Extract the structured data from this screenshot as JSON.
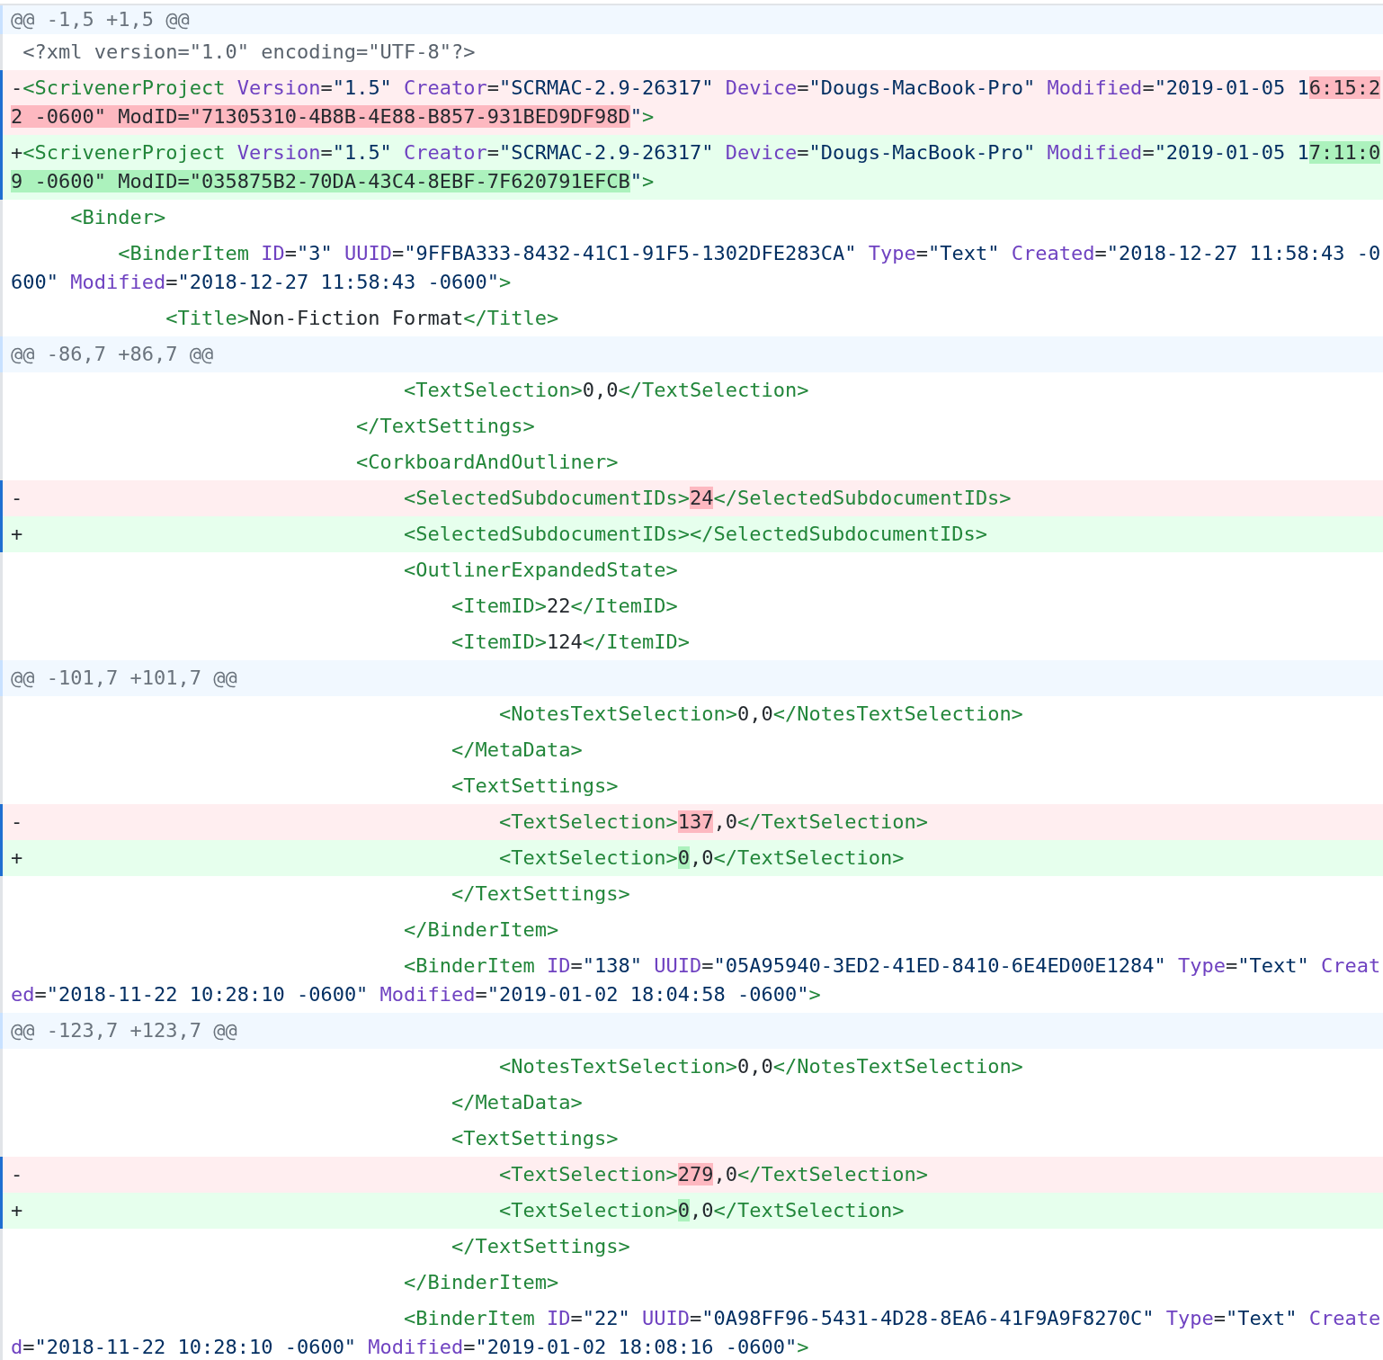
{
  "lines": [
    {
      "kind": "hunk",
      "text": "@@ -1,5 +1,5 @@"
    },
    {
      "kind": "context",
      "segments": [
        {
          "kind": "decl",
          "text": " <?xml version=\"1.0\" encoding=\"UTF-8\"?>",
          "highlighted": false
        }
      ]
    },
    {
      "kind": "del",
      "segments": [
        {
          "kind": "plain",
          "text": "-",
          "highlighted": false
        },
        {
          "kind": "tag",
          "text": "<ScrivenerProject",
          "highlighted": false
        },
        {
          "kind": "attr",
          "text": " Version",
          "highlighted": false
        },
        {
          "kind": "plain",
          "text": "=",
          "highlighted": false
        },
        {
          "kind": "str",
          "text": "\"1.5\"",
          "highlighted": false
        },
        {
          "kind": "attr",
          "text": " Creator",
          "highlighted": false
        },
        {
          "kind": "plain",
          "text": "=",
          "highlighted": false
        },
        {
          "kind": "str",
          "text": "\"SCRMAC-2.9-26317\"",
          "highlighted": false
        },
        {
          "kind": "attr",
          "text": " Device",
          "highlighted": false
        },
        {
          "kind": "plain",
          "text": "=",
          "highlighted": false
        },
        {
          "kind": "str",
          "text": "\"Dougs-MacBook-Pro\"",
          "highlighted": false
        },
        {
          "kind": "attr",
          "text": " Modified",
          "highlighted": false
        },
        {
          "kind": "plain",
          "text": "=",
          "highlighted": false
        },
        {
          "kind": "str",
          "text": "\"2019-01-05 1",
          "highlighted": false
        },
        {
          "kind": "plain",
          "text": "6:15:22 -0600\" ModID=\"71305310-4B8B-4E88-B857-931BED9DF98D",
          "highlighted": true
        },
        {
          "kind": "str",
          "text": "\"",
          "highlighted": false
        },
        {
          "kind": "tag",
          "text": ">",
          "highlighted": false
        }
      ]
    },
    {
      "kind": "add",
      "segments": [
        {
          "kind": "plain",
          "text": "+",
          "highlighted": false
        },
        {
          "kind": "tag",
          "text": "<ScrivenerProject",
          "highlighted": false
        },
        {
          "kind": "attr",
          "text": " Version",
          "highlighted": false
        },
        {
          "kind": "plain",
          "text": "=",
          "highlighted": false
        },
        {
          "kind": "str",
          "text": "\"1.5\"",
          "highlighted": false
        },
        {
          "kind": "attr",
          "text": " Creator",
          "highlighted": false
        },
        {
          "kind": "plain",
          "text": "=",
          "highlighted": false
        },
        {
          "kind": "str",
          "text": "\"SCRMAC-2.9-26317\"",
          "highlighted": false
        },
        {
          "kind": "attr",
          "text": " Device",
          "highlighted": false
        },
        {
          "kind": "plain",
          "text": "=",
          "highlighted": false
        },
        {
          "kind": "str",
          "text": "\"Dougs-MacBook-Pro\"",
          "highlighted": false
        },
        {
          "kind": "attr",
          "text": " Modified",
          "highlighted": false
        },
        {
          "kind": "plain",
          "text": "=",
          "highlighted": false
        },
        {
          "kind": "str",
          "text": "\"2019-01-05 1",
          "highlighted": false
        },
        {
          "kind": "plain",
          "text": "7:11:09 -0600\" ModID=\"035875B2-70DA-43C4-8EBF-7F620791EFCB",
          "highlighted": true
        },
        {
          "kind": "str",
          "text": "\"",
          "highlighted": false
        },
        {
          "kind": "tag",
          "text": ">",
          "highlighted": false
        }
      ]
    },
    {
      "kind": "context",
      "segments": [
        {
          "kind": "tag",
          "text": "     <Binder>",
          "highlighted": false
        }
      ]
    },
    {
      "kind": "context",
      "segments": [
        {
          "kind": "tag",
          "text": "         <BinderItem",
          "highlighted": false
        },
        {
          "kind": "attr",
          "text": " ID",
          "highlighted": false
        },
        {
          "kind": "plain",
          "text": "=",
          "highlighted": false
        },
        {
          "kind": "str",
          "text": "\"3\"",
          "highlighted": false
        },
        {
          "kind": "attr",
          "text": " UUID",
          "highlighted": false
        },
        {
          "kind": "plain",
          "text": "=",
          "highlighted": false
        },
        {
          "kind": "str",
          "text": "\"9FFBA333-8432-41C1-91F5-1302DFE283CA\"",
          "highlighted": false
        },
        {
          "kind": "attr",
          "text": " Type",
          "highlighted": false
        },
        {
          "kind": "plain",
          "text": "=",
          "highlighted": false
        },
        {
          "kind": "str",
          "text": "\"Text\"",
          "highlighted": false
        },
        {
          "kind": "attr",
          "text": " Created",
          "highlighted": false
        },
        {
          "kind": "plain",
          "text": "=",
          "highlighted": false
        },
        {
          "kind": "str",
          "text": "\"2018-12-27 11:58:43 -0600\"",
          "highlighted": false
        },
        {
          "kind": "attr",
          "text": " Modified",
          "highlighted": false
        },
        {
          "kind": "plain",
          "text": "=",
          "highlighted": false
        },
        {
          "kind": "str",
          "text": "\"2018-12-27 11:58:43 -0600\"",
          "highlighted": false
        },
        {
          "kind": "tag",
          "text": ">",
          "highlighted": false
        }
      ]
    },
    {
      "kind": "context",
      "segments": [
        {
          "kind": "tag",
          "text": "             <Title>",
          "highlighted": false
        },
        {
          "kind": "plain",
          "text": "Non-Fiction Format",
          "highlighted": false
        },
        {
          "kind": "tag",
          "text": "</Title>",
          "highlighted": false
        }
      ]
    },
    {
      "kind": "hunk",
      "text": "@@ -86,7 +86,7 @@"
    },
    {
      "kind": "context",
      "segments": [
        {
          "kind": "tag",
          "text": "                                 <TextSelection>",
          "highlighted": false
        },
        {
          "kind": "plain",
          "text": "0,0",
          "highlighted": false
        },
        {
          "kind": "tag",
          "text": "</TextSelection>",
          "highlighted": false
        }
      ]
    },
    {
      "kind": "context",
      "segments": [
        {
          "kind": "tag",
          "text": "                             </TextSettings>",
          "highlighted": false
        }
      ]
    },
    {
      "kind": "context",
      "segments": [
        {
          "kind": "tag",
          "text": "                             <CorkboardAndOutliner>",
          "highlighted": false
        }
      ]
    },
    {
      "kind": "del",
      "segments": [
        {
          "kind": "plain",
          "text": "-",
          "highlighted": false
        },
        {
          "kind": "tag",
          "text": "                                <SelectedSubdocumentIDs>",
          "highlighted": false
        },
        {
          "kind": "plain",
          "text": "24",
          "highlighted": true
        },
        {
          "kind": "tag",
          "text": "</SelectedSubdocumentIDs>",
          "highlighted": false
        }
      ]
    },
    {
      "kind": "add",
      "segments": [
        {
          "kind": "plain",
          "text": "+",
          "highlighted": false
        },
        {
          "kind": "tag",
          "text": "                                <SelectedSubdocumentIDs></SelectedSubdocumentIDs>",
          "highlighted": false
        }
      ]
    },
    {
      "kind": "context",
      "segments": [
        {
          "kind": "tag",
          "text": "                                 <OutlinerExpandedState>",
          "highlighted": false
        }
      ]
    },
    {
      "kind": "context",
      "segments": [
        {
          "kind": "tag",
          "text": "                                     <ItemID>",
          "highlighted": false
        },
        {
          "kind": "plain",
          "text": "22",
          "highlighted": false
        },
        {
          "kind": "tag",
          "text": "</ItemID>",
          "highlighted": false
        }
      ]
    },
    {
      "kind": "context",
      "segments": [
        {
          "kind": "tag",
          "text": "                                     <ItemID>",
          "highlighted": false
        },
        {
          "kind": "plain",
          "text": "124",
          "highlighted": false
        },
        {
          "kind": "tag",
          "text": "</ItemID>",
          "highlighted": false
        }
      ]
    },
    {
      "kind": "hunk",
      "text": "@@ -101,7 +101,7 @@"
    },
    {
      "kind": "context",
      "segments": [
        {
          "kind": "tag",
          "text": "                                         <NotesTextSelection>",
          "highlighted": false
        },
        {
          "kind": "plain",
          "text": "0,0",
          "highlighted": false
        },
        {
          "kind": "tag",
          "text": "</NotesTextSelection>",
          "highlighted": false
        }
      ]
    },
    {
      "kind": "context",
      "segments": [
        {
          "kind": "tag",
          "text": "                                     </MetaData>",
          "highlighted": false
        }
      ]
    },
    {
      "kind": "context",
      "segments": [
        {
          "kind": "tag",
          "text": "                                     <TextSettings>",
          "highlighted": false
        }
      ]
    },
    {
      "kind": "del",
      "segments": [
        {
          "kind": "plain",
          "text": "-",
          "highlighted": false
        },
        {
          "kind": "tag",
          "text": "                                        <TextSelection>",
          "highlighted": false
        },
        {
          "kind": "plain",
          "text": "137",
          "highlighted": true
        },
        {
          "kind": "plain",
          "text": ",0",
          "highlighted": false
        },
        {
          "kind": "tag",
          "text": "</TextSelection>",
          "highlighted": false
        }
      ]
    },
    {
      "kind": "add",
      "segments": [
        {
          "kind": "plain",
          "text": "+",
          "highlighted": false
        },
        {
          "kind": "tag",
          "text": "                                        <TextSelection>",
          "highlighted": false
        },
        {
          "kind": "plain",
          "text": "0",
          "highlighted": true
        },
        {
          "kind": "plain",
          "text": ",0",
          "highlighted": false
        },
        {
          "kind": "tag",
          "text": "</TextSelection>",
          "highlighted": false
        }
      ]
    },
    {
      "kind": "context",
      "segments": [
        {
          "kind": "tag",
          "text": "                                     </TextSettings>",
          "highlighted": false
        }
      ]
    },
    {
      "kind": "context",
      "segments": [
        {
          "kind": "tag",
          "text": "                                 </BinderItem>",
          "highlighted": false
        }
      ]
    },
    {
      "kind": "context",
      "segments": [
        {
          "kind": "tag",
          "text": "                                 <BinderItem",
          "highlighted": false
        },
        {
          "kind": "attr",
          "text": " ID",
          "highlighted": false
        },
        {
          "kind": "plain",
          "text": "=",
          "highlighted": false
        },
        {
          "kind": "str",
          "text": "\"138\"",
          "highlighted": false
        },
        {
          "kind": "attr",
          "text": " UUID",
          "highlighted": false
        },
        {
          "kind": "plain",
          "text": "=",
          "highlighted": false
        },
        {
          "kind": "str",
          "text": "\"05A95940-3ED2-41ED-8410-6E4ED00E1284\"",
          "highlighted": false
        },
        {
          "kind": "attr",
          "text": " Type",
          "highlighted": false
        },
        {
          "kind": "plain",
          "text": "=",
          "highlighted": false
        },
        {
          "kind": "str",
          "text": "\"Text\"",
          "highlighted": false
        },
        {
          "kind": "attr",
          "text": " Created",
          "highlighted": false
        },
        {
          "kind": "plain",
          "text": "=",
          "highlighted": false
        },
        {
          "kind": "str",
          "text": "\"2018-11-22 10:28:10 -0600\"",
          "highlighted": false
        },
        {
          "kind": "attr",
          "text": " Modified",
          "highlighted": false
        },
        {
          "kind": "plain",
          "text": "=",
          "highlighted": false
        },
        {
          "kind": "str",
          "text": "\"2019-01-02 18:04:58 -0600\"",
          "highlighted": false
        },
        {
          "kind": "tag",
          "text": ">",
          "highlighted": false
        }
      ]
    },
    {
      "kind": "hunk",
      "text": "@@ -123,7 +123,7 @@"
    },
    {
      "kind": "context",
      "segments": [
        {
          "kind": "tag",
          "text": "                                         <NotesTextSelection>",
          "highlighted": false
        },
        {
          "kind": "plain",
          "text": "0,0",
          "highlighted": false
        },
        {
          "kind": "tag",
          "text": "</NotesTextSelection>",
          "highlighted": false
        }
      ]
    },
    {
      "kind": "context",
      "segments": [
        {
          "kind": "tag",
          "text": "                                     </MetaData>",
          "highlighted": false
        }
      ]
    },
    {
      "kind": "context",
      "segments": [
        {
          "kind": "tag",
          "text": "                                     <TextSettings>",
          "highlighted": false
        }
      ]
    },
    {
      "kind": "del",
      "segments": [
        {
          "kind": "plain",
          "text": "-",
          "highlighted": false
        },
        {
          "kind": "tag",
          "text": "                                        <TextSelection>",
          "highlighted": false
        },
        {
          "kind": "plain",
          "text": "279",
          "highlighted": true
        },
        {
          "kind": "plain",
          "text": ",0",
          "highlighted": false
        },
        {
          "kind": "tag",
          "text": "</TextSelection>",
          "highlighted": false
        }
      ]
    },
    {
      "kind": "add",
      "segments": [
        {
          "kind": "plain",
          "text": "+",
          "highlighted": false
        },
        {
          "kind": "tag",
          "text": "                                        <TextSelection>",
          "highlighted": false
        },
        {
          "kind": "plain",
          "text": "0",
          "highlighted": true
        },
        {
          "kind": "plain",
          "text": ",0",
          "highlighted": false
        },
        {
          "kind": "tag",
          "text": "</TextSelection>",
          "highlighted": false
        }
      ]
    },
    {
      "kind": "context",
      "segments": [
        {
          "kind": "tag",
          "text": "                                     </TextSettings>",
          "highlighted": false
        }
      ]
    },
    {
      "kind": "context",
      "segments": [
        {
          "kind": "tag",
          "text": "                                 </BinderItem>",
          "highlighted": false
        }
      ]
    },
    {
      "kind": "context",
      "segments": [
        {
          "kind": "tag",
          "text": "                                 <BinderItem",
          "highlighted": false
        },
        {
          "kind": "attr",
          "text": " ID",
          "highlighted": false
        },
        {
          "kind": "plain",
          "text": "=",
          "highlighted": false
        },
        {
          "kind": "str",
          "text": "\"22\"",
          "highlighted": false
        },
        {
          "kind": "attr",
          "text": " UUID",
          "highlighted": false
        },
        {
          "kind": "plain",
          "text": "=",
          "highlighted": false
        },
        {
          "kind": "str",
          "text": "\"0A98FF96-5431-4D28-8EA6-41F9A9F8270C\"",
          "highlighted": false
        },
        {
          "kind": "attr",
          "text": " Type",
          "highlighted": false
        },
        {
          "kind": "plain",
          "text": "=",
          "highlighted": false
        },
        {
          "kind": "str",
          "text": "\"Text\"",
          "highlighted": false
        },
        {
          "kind": "attr",
          "text": " Created",
          "highlighted": false
        },
        {
          "kind": "plain",
          "text": "=",
          "highlighted": false
        },
        {
          "kind": "str",
          "text": "\"2018-11-22 10:28:10 -0600\"",
          "highlighted": false
        },
        {
          "kind": "attr",
          "text": " Modified",
          "highlighted": false
        },
        {
          "kind": "plain",
          "text": "=",
          "highlighted": false
        },
        {
          "kind": "str",
          "text": "\"2019-01-02 18:08:16 -0600\"",
          "highlighted": false
        },
        {
          "kind": "tag",
          "text": ">",
          "highlighted": false
        }
      ]
    }
  ]
}
